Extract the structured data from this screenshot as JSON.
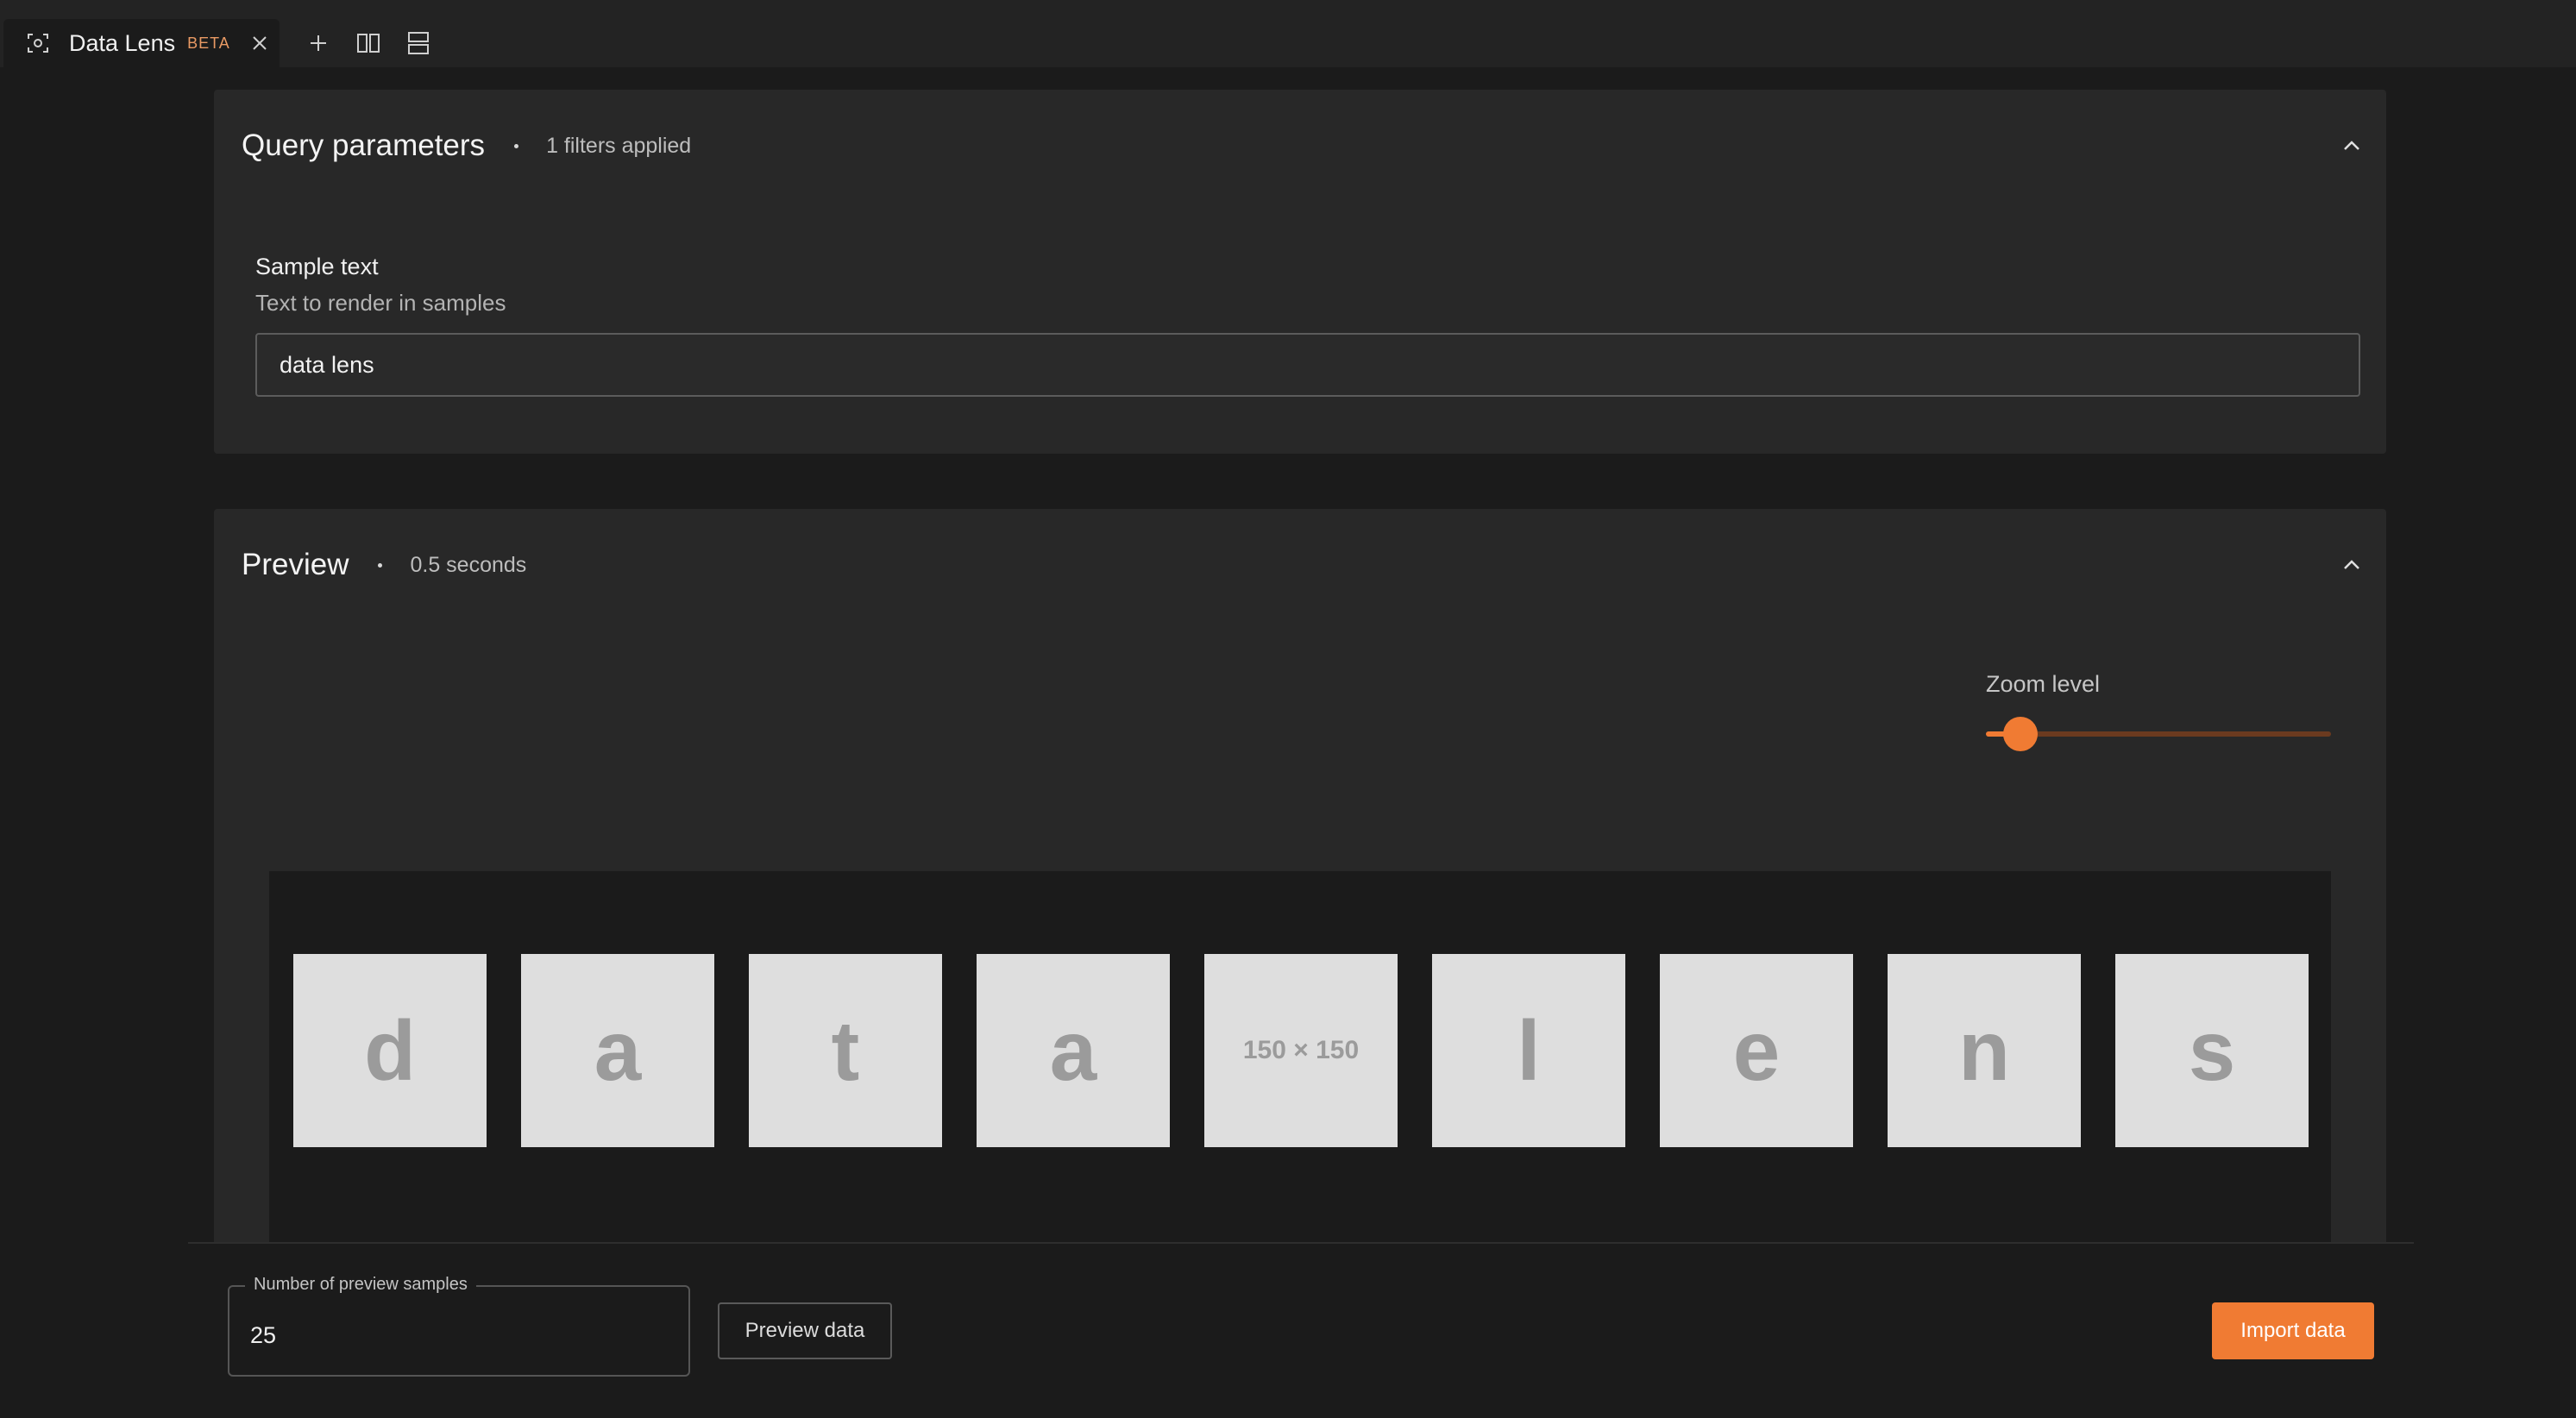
{
  "tabbar": {
    "tab_title": "Data Lens",
    "tab_badge": "BETA",
    "icons": [
      "data-lens-icon",
      "close-icon",
      "plus-icon",
      "split-vertical-icon",
      "split-horizontal-icon"
    ]
  },
  "query": {
    "title": "Query parameters",
    "subtitle": "1 filters applied",
    "field_label": "Sample text",
    "field_help": "Text to render in samples",
    "field_value": "data lens"
  },
  "preview": {
    "title": "Preview",
    "subtitle": "0.5 seconds",
    "zoom_label": "Zoom level",
    "zoom_fraction": 0.1,
    "tiles": [
      "d",
      "a",
      "t",
      "a",
      "150 × 150",
      "l",
      "e",
      "n",
      "s"
    ]
  },
  "footer": {
    "samples_legend": "Number of preview samples",
    "samples_value": "25",
    "preview_button": "Preview data",
    "import_button": "Import data"
  },
  "colors": {
    "accent": "#f07b33",
    "beta_badge": "#e99a64",
    "background": "#1b1b1b",
    "panel": "#282828"
  }
}
